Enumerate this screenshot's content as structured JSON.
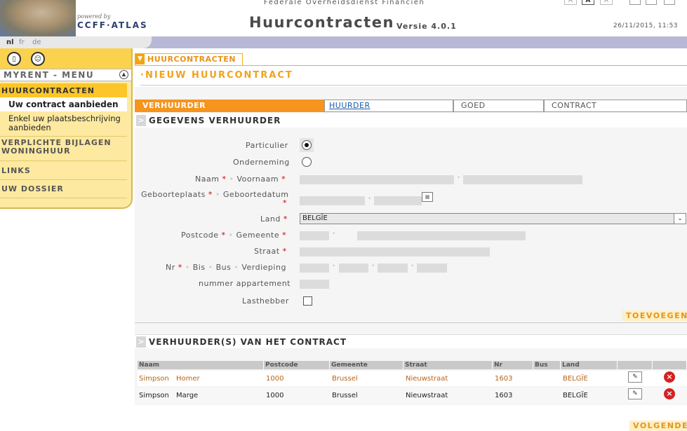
{
  "header": {
    "powered_by": "powered by",
    "brand": "CCFF·ATLAS",
    "agency": "Federale Overheidsdienst Financiën",
    "app_title": "Huurcontracten",
    "version": "Versie 4.0.1",
    "datetime": "26/11/2015, 11:53",
    "font_sizes": [
      "A",
      "A",
      "A"
    ]
  },
  "languages": [
    "nl",
    "fr",
    "de"
  ],
  "sidebar": {
    "menu_title": "MYRENT - MENU",
    "items": [
      {
        "label": "HUURCONTRACTEN"
      },
      {
        "label": "Uw contract aanbieden"
      },
      {
        "label": "Enkel uw plaatsbeschrijving aanbieden"
      },
      {
        "label": "VERPLICHTE BIJLAGEN WONINGHUUR"
      },
      {
        "label": "LINKS"
      },
      {
        "label": "UW DOSSIER"
      }
    ]
  },
  "breadcrumb": "HUURCONTRACTEN",
  "page_title": "·NIEUW HUURCONTRACT",
  "tabs": [
    "VERHUURDER",
    "HUURDER",
    "GOED",
    "CONTRACT"
  ],
  "form": {
    "section_title": "GEGEVENS VERHUURDER",
    "labels": {
      "particulier": "Particulier",
      "onderneming": "Onderneming",
      "naam": "Naam",
      "voornaam": "Voornaam",
      "geboorteplaats": "Geboorteplaats",
      "geboortedatum": "Geboortedatum",
      "land": "Land",
      "postcode": "Postcode",
      "gemeente": "Gemeente",
      "straat": "Straat",
      "nr": "Nr",
      "bis": "Bis",
      "bus": "Bus",
      "verdieping": "Verdieping",
      "appartement": "nummer appartement",
      "lasthebber": "Lasthebber"
    },
    "selected_type": "Particulier",
    "country_value": "BELGÏE",
    "add_button": "TOEVOEGEN"
  },
  "table": {
    "section_title": "VERHUURDER(S) VAN HET CONTRACT",
    "columns": [
      "Naam",
      "Postcode",
      "Gemeente",
      "Straat",
      "Nr",
      "Bus",
      "Land"
    ],
    "rows": [
      {
        "achternaam": "Simpson",
        "voornaam": "Homer",
        "postcode": "1000",
        "gemeente": "Brussel",
        "straat": "Nieuwstraat",
        "nr": "1603",
        "bus": "",
        "land": "BELGÏE"
      },
      {
        "achternaam": "Simpson",
        "voornaam": "Marge",
        "postcode": "1000",
        "gemeente": "Brussel",
        "straat": "Nieuwstraat",
        "nr": "1603",
        "bus": "",
        "land": "BELGÏE"
      }
    ]
  },
  "next_button": "VOLGENDE",
  "colors": {
    "accent": "#f7941d",
    "sidebar": "#fde9a0",
    "sidebar_active": "#fcc52a",
    "link": "#1a5aa8"
  }
}
